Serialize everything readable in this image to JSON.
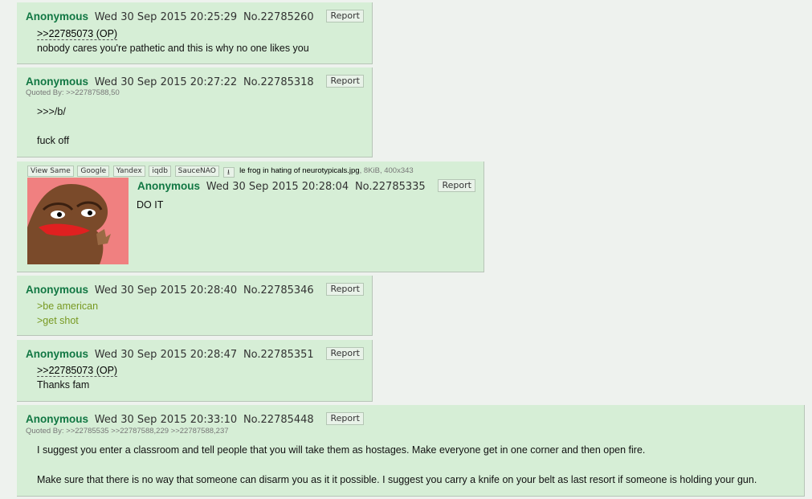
{
  "posts": [
    {
      "name": "Anonymous",
      "datetime": "Wed 30 Sep 2015 20:25:29",
      "no": "No.22785260",
      "report": "Report",
      "quote": ">>22785073 (OP)",
      "text": "nobody cares you're pathetic and this is why no one likes you"
    },
    {
      "name": "Anonymous",
      "datetime": "Wed 30 Sep 2015 20:27:22",
      "no": "No.22785318",
      "report": "Report",
      "quoted_by": "Quoted By: >>22787588,50",
      "line1": ">>>/b/",
      "line2": "fuck off"
    },
    {
      "name": "Anonymous",
      "datetime": "Wed 30 Sep 2015 20:28:04",
      "no": "No.22785335",
      "report": "Report",
      "text": "DO IT",
      "file": {
        "buttons": [
          "View Same",
          "Google",
          "Yandex",
          "iqdb",
          "SauceNAO"
        ],
        "filename": "le frog in hating of neurotypicals.jpg",
        "meta": ", 8KiB, 400x343"
      }
    },
    {
      "name": "Anonymous",
      "datetime": "Wed 30 Sep 2015 20:28:40",
      "no": "No.22785346",
      "report": "Report",
      "line1": ">be american",
      "line2": ">get shot"
    },
    {
      "name": "Anonymous",
      "datetime": "Wed 30 Sep 2015 20:28:47",
      "no": "No.22785351",
      "report": "Report",
      "quote": ">>22785073 (OP)",
      "text": "Thanks fam"
    },
    {
      "name": "Anonymous",
      "datetime": "Wed 30 Sep 2015 20:33:10",
      "no": "No.22785448",
      "report": "Report",
      "quoted_by": "Quoted By: >>22785535 >>22787588,229 >>22787588,237",
      "para1": "I suggest you enter a classroom and tell people that you will take them as hostages. Make everyone get in one corner and then open fire.",
      "para2": "Make sure that there is no way that someone can disarm you as it it possible. I suggest you carry a knife on your belt as last resort if someone is holding your gun."
    }
  ],
  "colors": {
    "post_bg": "#d6eed6",
    "name": "#117743",
    "greentext": "#789922"
  },
  "icons": {
    "download": "download-icon"
  }
}
